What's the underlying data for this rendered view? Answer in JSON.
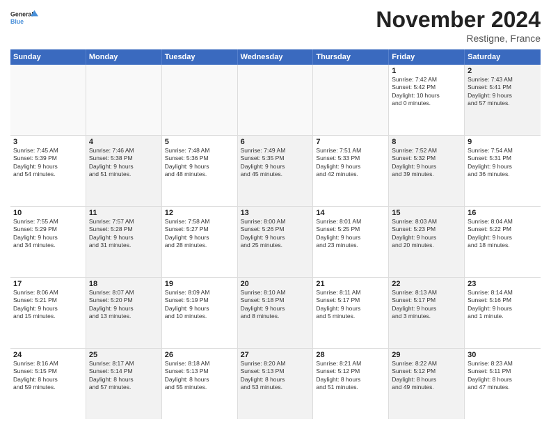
{
  "logo": {
    "general": "General",
    "blue": "Blue"
  },
  "header": {
    "month": "November 2024",
    "location": "Restigne, France"
  },
  "weekdays": [
    "Sunday",
    "Monday",
    "Tuesday",
    "Wednesday",
    "Thursday",
    "Friday",
    "Saturday"
  ],
  "weeks": [
    [
      {
        "day": "",
        "empty": true
      },
      {
        "day": "",
        "empty": true
      },
      {
        "day": "",
        "empty": true
      },
      {
        "day": "",
        "empty": true
      },
      {
        "day": "",
        "empty": true
      },
      {
        "day": "1",
        "lines": [
          "Sunrise: 7:42 AM",
          "Sunset: 5:42 PM",
          "Daylight: 10 hours",
          "and 0 minutes."
        ]
      },
      {
        "day": "2",
        "shaded": true,
        "lines": [
          "Sunrise: 7:43 AM",
          "Sunset: 5:41 PM",
          "Daylight: 9 hours",
          "and 57 minutes."
        ]
      }
    ],
    [
      {
        "day": "3",
        "lines": [
          "Sunrise: 7:45 AM",
          "Sunset: 5:39 PM",
          "Daylight: 9 hours",
          "and 54 minutes."
        ]
      },
      {
        "day": "4",
        "shaded": true,
        "lines": [
          "Sunrise: 7:46 AM",
          "Sunset: 5:38 PM",
          "Daylight: 9 hours",
          "and 51 minutes."
        ]
      },
      {
        "day": "5",
        "lines": [
          "Sunrise: 7:48 AM",
          "Sunset: 5:36 PM",
          "Daylight: 9 hours",
          "and 48 minutes."
        ]
      },
      {
        "day": "6",
        "shaded": true,
        "lines": [
          "Sunrise: 7:49 AM",
          "Sunset: 5:35 PM",
          "Daylight: 9 hours",
          "and 45 minutes."
        ]
      },
      {
        "day": "7",
        "lines": [
          "Sunrise: 7:51 AM",
          "Sunset: 5:33 PM",
          "Daylight: 9 hours",
          "and 42 minutes."
        ]
      },
      {
        "day": "8",
        "shaded": true,
        "lines": [
          "Sunrise: 7:52 AM",
          "Sunset: 5:32 PM",
          "Daylight: 9 hours",
          "and 39 minutes."
        ]
      },
      {
        "day": "9",
        "lines": [
          "Sunrise: 7:54 AM",
          "Sunset: 5:31 PM",
          "Daylight: 9 hours",
          "and 36 minutes."
        ]
      }
    ],
    [
      {
        "day": "10",
        "lines": [
          "Sunrise: 7:55 AM",
          "Sunset: 5:29 PM",
          "Daylight: 9 hours",
          "and 34 minutes."
        ]
      },
      {
        "day": "11",
        "shaded": true,
        "lines": [
          "Sunrise: 7:57 AM",
          "Sunset: 5:28 PM",
          "Daylight: 9 hours",
          "and 31 minutes."
        ]
      },
      {
        "day": "12",
        "lines": [
          "Sunrise: 7:58 AM",
          "Sunset: 5:27 PM",
          "Daylight: 9 hours",
          "and 28 minutes."
        ]
      },
      {
        "day": "13",
        "shaded": true,
        "lines": [
          "Sunrise: 8:00 AM",
          "Sunset: 5:26 PM",
          "Daylight: 9 hours",
          "and 25 minutes."
        ]
      },
      {
        "day": "14",
        "lines": [
          "Sunrise: 8:01 AM",
          "Sunset: 5:25 PM",
          "Daylight: 9 hours",
          "and 23 minutes."
        ]
      },
      {
        "day": "15",
        "shaded": true,
        "lines": [
          "Sunrise: 8:03 AM",
          "Sunset: 5:23 PM",
          "Daylight: 9 hours",
          "and 20 minutes."
        ]
      },
      {
        "day": "16",
        "lines": [
          "Sunrise: 8:04 AM",
          "Sunset: 5:22 PM",
          "Daylight: 9 hours",
          "and 18 minutes."
        ]
      }
    ],
    [
      {
        "day": "17",
        "lines": [
          "Sunrise: 8:06 AM",
          "Sunset: 5:21 PM",
          "Daylight: 9 hours",
          "and 15 minutes."
        ]
      },
      {
        "day": "18",
        "shaded": true,
        "lines": [
          "Sunrise: 8:07 AM",
          "Sunset: 5:20 PM",
          "Daylight: 9 hours",
          "and 13 minutes."
        ]
      },
      {
        "day": "19",
        "lines": [
          "Sunrise: 8:09 AM",
          "Sunset: 5:19 PM",
          "Daylight: 9 hours",
          "and 10 minutes."
        ]
      },
      {
        "day": "20",
        "shaded": true,
        "lines": [
          "Sunrise: 8:10 AM",
          "Sunset: 5:18 PM",
          "Daylight: 9 hours",
          "and 8 minutes."
        ]
      },
      {
        "day": "21",
        "lines": [
          "Sunrise: 8:11 AM",
          "Sunset: 5:17 PM",
          "Daylight: 9 hours",
          "and 5 minutes."
        ]
      },
      {
        "day": "22",
        "shaded": true,
        "lines": [
          "Sunrise: 8:13 AM",
          "Sunset: 5:17 PM",
          "Daylight: 9 hours",
          "and 3 minutes."
        ]
      },
      {
        "day": "23",
        "lines": [
          "Sunrise: 8:14 AM",
          "Sunset: 5:16 PM",
          "Daylight: 9 hours",
          "and 1 minute."
        ]
      }
    ],
    [
      {
        "day": "24",
        "lines": [
          "Sunrise: 8:16 AM",
          "Sunset: 5:15 PM",
          "Daylight: 8 hours",
          "and 59 minutes."
        ]
      },
      {
        "day": "25",
        "shaded": true,
        "lines": [
          "Sunrise: 8:17 AM",
          "Sunset: 5:14 PM",
          "Daylight: 8 hours",
          "and 57 minutes."
        ]
      },
      {
        "day": "26",
        "lines": [
          "Sunrise: 8:18 AM",
          "Sunset: 5:13 PM",
          "Daylight: 8 hours",
          "and 55 minutes."
        ]
      },
      {
        "day": "27",
        "shaded": true,
        "lines": [
          "Sunrise: 8:20 AM",
          "Sunset: 5:13 PM",
          "Daylight: 8 hours",
          "and 53 minutes."
        ]
      },
      {
        "day": "28",
        "lines": [
          "Sunrise: 8:21 AM",
          "Sunset: 5:12 PM",
          "Daylight: 8 hours",
          "and 51 minutes."
        ]
      },
      {
        "day": "29",
        "shaded": true,
        "lines": [
          "Sunrise: 8:22 AM",
          "Sunset: 5:12 PM",
          "Daylight: 8 hours",
          "and 49 minutes."
        ]
      },
      {
        "day": "30",
        "lines": [
          "Sunrise: 8:23 AM",
          "Sunset: 5:11 PM",
          "Daylight: 8 hours",
          "and 47 minutes."
        ]
      }
    ]
  ]
}
